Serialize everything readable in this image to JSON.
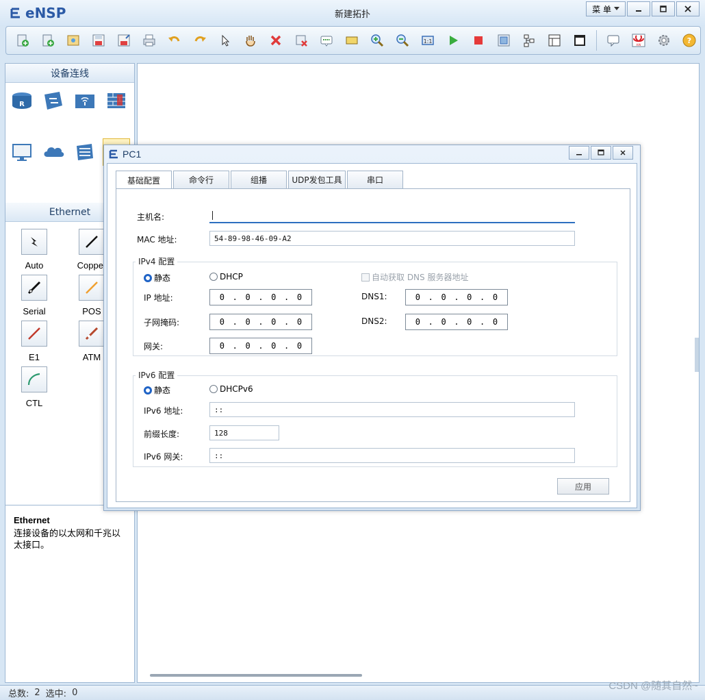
{
  "app": {
    "name": "eNSP",
    "window_title": "新建拓扑",
    "menu_label": "菜 单"
  },
  "toolbar": {
    "icons": [
      "new-topo-icon",
      "new-test-icon",
      "open-icon",
      "save-icon",
      "save-as-icon",
      "print-icon",
      "undo-icon",
      "redo-icon",
      "select-icon",
      "pan-icon",
      "delete-icon",
      "delete-all-icon",
      "text-icon",
      "rect-icon",
      "zoom-in-icon",
      "zoom-out-icon",
      "fit-icon",
      "start-icon",
      "stop-icon",
      "capture-icon",
      "topology-icon",
      "grid-icon",
      "terminal-icon",
      "chat-icon",
      "huawei-icon",
      "settings-icon",
      "help-icon"
    ]
  },
  "left_panel": {
    "devices_title": "设备连线",
    "ethernet_title": "Ethernet",
    "cables": [
      {
        "label": "Auto"
      },
      {
        "label": "Copper"
      },
      {
        "label": "Serial"
      },
      {
        "label": "POS"
      },
      {
        "label": "E1"
      },
      {
        "label": "ATM"
      },
      {
        "label": "CTL"
      }
    ],
    "description_title": "Ethernet",
    "description_text": "连接设备的以太网和千兆以太接口。"
  },
  "status": {
    "total_label": "总数:",
    "total_value": "2",
    "selected_label": "选中:",
    "selected_value": "0"
  },
  "watermark": "CSDN @随其自然~",
  "dialog": {
    "title": "PC1",
    "tabs": [
      "基础配置",
      "命令行",
      "组播",
      "UDP发包工具",
      "串口"
    ],
    "hostname_label": "主机名:",
    "hostname_value": "",
    "mac_label": "MAC 地址:",
    "mac_value": "54-89-98-46-09-A2",
    "ipv4": {
      "group_title": "IPv4 配置",
      "static_label": "静态",
      "dhcp_label": "DHCP",
      "auto_dns_label": "自动获取 DNS 服务器地址",
      "ip_label": "IP 地址:",
      "mask_label": "子网掩码:",
      "gateway_label": "网关:",
      "dns1_label": "DNS1:",
      "dns2_label": "DNS2:",
      "ip": [
        "0",
        "0",
        "0",
        "0"
      ],
      "mask": [
        "0",
        "0",
        "0",
        "0"
      ],
      "gateway": [
        "0",
        "0",
        "0",
        "0"
      ],
      "dns1": [
        "0",
        "0",
        "0",
        "0"
      ],
      "dns2": [
        "0",
        "0",
        "0",
        "0"
      ]
    },
    "ipv6": {
      "group_title": "IPv6 配置",
      "static_label": "静态",
      "dhcp_label": "DHCPv6",
      "ip_label": "IPv6 地址:",
      "ip_value": "::",
      "prefix_label": "前缀长度:",
      "prefix_value": "128",
      "gateway_label": "IPv6 网关:",
      "gateway_value": "::"
    },
    "apply_label": "应用"
  }
}
